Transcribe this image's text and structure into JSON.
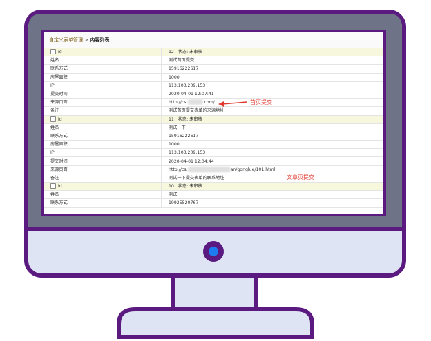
{
  "breadcrumb": {
    "level1": "自定义表单管理",
    "sep": ">",
    "current": "内容列表"
  },
  "records": [
    {
      "head": {
        "label": "id",
        "value": "12",
        "status": "状态: 未审核"
      },
      "rows": [
        {
          "label": "姓名",
          "value": "测试首页提交"
        },
        {
          "label": "联系方式",
          "value": "15916222617"
        },
        {
          "label": "房屋面积",
          "value": "1000"
        },
        {
          "label": "IP",
          "value": "113.103.209.153"
        },
        {
          "label": "提交时间",
          "value": "2020-04-01 12:07:41"
        },
        {
          "label": "来源页面",
          "value_prefix": "http://cs.",
          "value_suffix": ".com/"
        },
        {
          "label": "备注",
          "value": "测试首页提交表单的来源地址"
        }
      ]
    },
    {
      "head": {
        "label": "id",
        "value": "11",
        "status": "状态: 未审核"
      },
      "rows": [
        {
          "label": "姓名",
          "value": "测试一下"
        },
        {
          "label": "联系方式",
          "value": "15916222617"
        },
        {
          "label": "房屋面积",
          "value": "1000"
        },
        {
          "label": "IP",
          "value": "113.103.209.153"
        },
        {
          "label": "提交时间",
          "value": "2020-04-01 12:04:44"
        },
        {
          "label": "来源页面",
          "value_prefix": "http://cs.",
          "value_suffix": "an/gonglue/101.html"
        },
        {
          "label": "备注",
          "value": "测试一下提交表单的联系地址"
        }
      ]
    },
    {
      "head": {
        "label": "id",
        "value": "10",
        "status": "状态: 未审核"
      },
      "rows": [
        {
          "label": "姓名",
          "value": "测试"
        },
        {
          "label": "联系方式",
          "value": "19925520767"
        }
      ]
    }
  ],
  "annotations": {
    "homepage_submit": "首页提交",
    "article_submit": "文章页提交"
  },
  "colors": {
    "frame": "#5a1a80",
    "bezel": "#6f7388",
    "body": "#dfe4f5",
    "accent": "#e03a2f",
    "header_row": "#f6f7dc",
    "power_light": "#1f7cf0"
  }
}
